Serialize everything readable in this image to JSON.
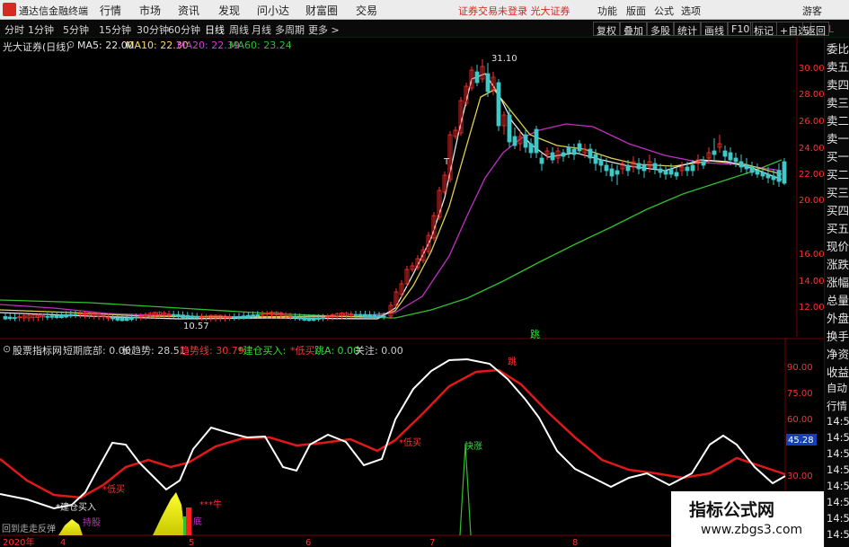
{
  "menubar": {
    "app_title": "通达信金融终端",
    "menus": [
      "行情",
      "市场",
      "资讯",
      "发现",
      "问小达",
      "财富圈",
      "交易"
    ],
    "login_notice": "证券交易未登录  光大证券",
    "right_menus": [
      "功能",
      "版面",
      "公式",
      "选项",
      "游客"
    ]
  },
  "toolbar": {
    "periods": [
      "分时",
      "1分钟",
      "5分钟",
      "15分钟",
      "30分钟",
      "60分钟",
      "日线",
      "周线",
      "月线",
      "多周期",
      "更多 >"
    ],
    "active_period": "日线",
    "buttons": [
      "复权",
      "叠加",
      "多股",
      "统计",
      "画线",
      "F10",
      "标记",
      "+自选",
      "返回"
    ]
  },
  "main_chart": {
    "title": "光大证券(日线)",
    "ma": [
      {
        "label": "MA5: 22.00",
        "color": "#e8e8e8"
      },
      {
        "label": "MA10: 22.30",
        "color": "#f0e060"
      },
      {
        "label": "MA20: 22.39",
        "color": "#d040d0"
      },
      {
        "label": "MA60: 23.24",
        "color": "#30c030"
      }
    ],
    "high_label": "31.10",
    "low_label": "10.57",
    "t_mark": "T",
    "jump_label": "跳",
    "price_ticks": [
      "30.00",
      "28.00",
      "26.00",
      "24.00",
      "22.00",
      "20.00",
      "16.00",
      "14.00",
      "12.00"
    ],
    "bg_color": "#000000",
    "up_color": "#ff3030",
    "down_color": "#40c8c8"
  },
  "sub_chart": {
    "name": "股票指标网",
    "items": [
      {
        "label": "短期底部: 0.00",
        "color": "#cfcfcf"
      },
      {
        "label": "长趋势: 28.51",
        "color": "#cfcfcf"
      },
      {
        "label": "趋势线: 30.79",
        "color": "#ff3030"
      },
      {
        "label": "*建仓买入:",
        "color": "#30e030"
      },
      {
        "label": "*低买",
        "color": "#ff3030"
      },
      {
        "label": "跳A: 0.00",
        "color": "#30e030"
      },
      {
        "label": "关注: 0.00",
        "color": "#cfcfcf"
      }
    ],
    "y_ticks": [
      "90.00",
      "75.00",
      "60.00",
      "45.28",
      "30.00"
    ],
    "current_value": "45.28",
    "annotations": {
      "low_buy_1": "*低买",
      "low_buy_2": "*低买",
      "build_buy": "*建仓买入",
      "stars": "***牛",
      "fast_rise": "快涨",
      "jump": "跳",
      "hold": "持股",
      "bottom": "底",
      "trend_forming": "回到走走反弹"
    }
  },
  "x_axis": {
    "labels": [
      "2020年",
      "4",
      "5",
      "6",
      "7",
      "8"
    ]
  },
  "right_tabs": [
    "委比",
    "卖五",
    "卖四",
    "卖三",
    "卖二",
    "卖一",
    "买一",
    "买二",
    "买三",
    "买四",
    "买五",
    "现价",
    "涨跌",
    "涨幅",
    "总量",
    "外盘",
    "换手",
    "净资",
    "收益",
    "自动",
    "行情",
    "14:5",
    "14:5",
    "14:5",
    "14:5",
    "14:5",
    "14:5",
    "14:5",
    "14:5",
    "14:5"
  ],
  "watermark": {
    "line1": "指标公式网",
    "line2": "www.zbgs3.com"
  }
}
